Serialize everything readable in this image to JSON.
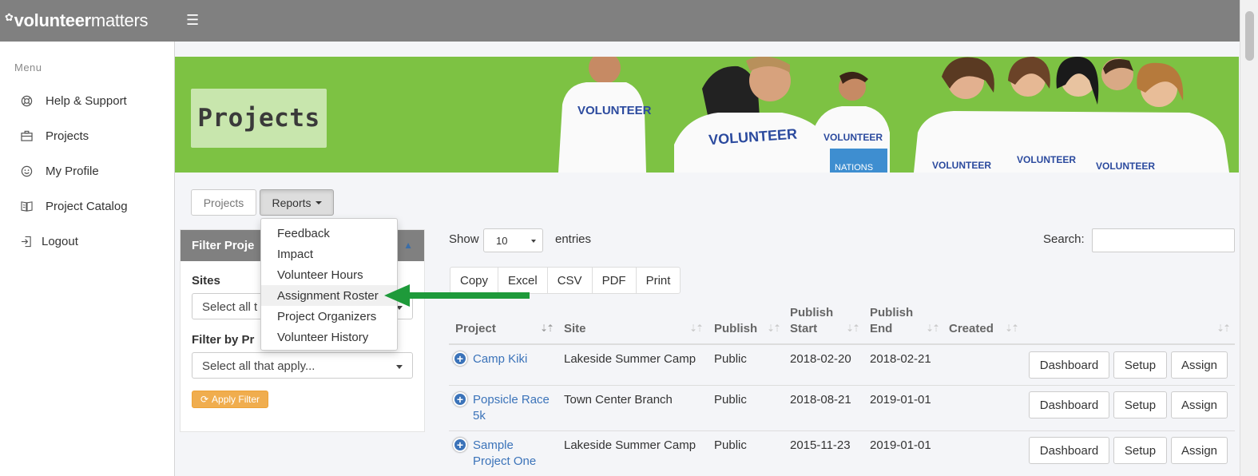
{
  "brand": {
    "logo_prefix": "volunteer",
    "logo_suffix": "matters"
  },
  "sidebar": {
    "menu_title": "Menu",
    "items": [
      {
        "label": "Help & Support",
        "icon": "lifebuoy-icon"
      },
      {
        "label": "Projects",
        "icon": "briefcase-icon"
      },
      {
        "label": "My Profile",
        "icon": "smiley-icon"
      },
      {
        "label": "Project Catalog",
        "icon": "book-icon"
      },
      {
        "label": "Logout",
        "icon": "logout-icon"
      }
    ]
  },
  "banner": {
    "title": "Projects",
    "shirt_text": "VOLUNTEER",
    "box_text": "NATIONS"
  },
  "tabs": {
    "projects": "Projects",
    "reports": "Reports"
  },
  "reports_menu": [
    "Feedback",
    "Impact",
    "Volunteer Hours",
    "Assignment Roster",
    "Project Organizers",
    "Volunteer History"
  ],
  "filter": {
    "header": "Filter Proje",
    "sites_label": "Sites",
    "sites_placeholder": "Select all t",
    "by_label": "Filter by Pr",
    "by_placeholder": "Select all that apply...",
    "apply": "Apply Filter"
  },
  "table_controls": {
    "show": "Show",
    "length": "10",
    "entries": "entries",
    "search": "Search:"
  },
  "export_buttons": [
    "Copy",
    "Excel",
    "CSV",
    "PDF",
    "Print"
  ],
  "columns": {
    "project": "Project",
    "site": "Site",
    "publish": "Publish",
    "publish_start_1": "Publish",
    "publish_start_2": "Start",
    "publish_end_1": "Publish",
    "publish_end_2": "End",
    "created": "Created"
  },
  "rows": [
    {
      "p1": "Camp Kiki",
      "p2": "",
      "site": "Lakeside Summer Camp",
      "publish": "Public",
      "start": "2018-02-20",
      "end": "2018-02-21"
    },
    {
      "p1": "Popsicle Race",
      "p2": "5k",
      "site": "Town Center Branch",
      "publish": "Public",
      "start": "2018-08-21",
      "end": "2019-01-01"
    },
    {
      "p1": "Sample",
      "p2": "Project One",
      "site": "Lakeside Summer Camp",
      "publish": "Public",
      "start": "2015-11-23",
      "end": "2019-01-01"
    }
  ],
  "row_actions": {
    "dashboard": "Dashboard",
    "setup": "Setup",
    "assign": "Assign"
  },
  "colors": {
    "topbar": "#808080",
    "banner": "#7dc243",
    "link": "#3b73b9",
    "apply": "#f0ad4e",
    "arrow": "#1e9a3a"
  }
}
